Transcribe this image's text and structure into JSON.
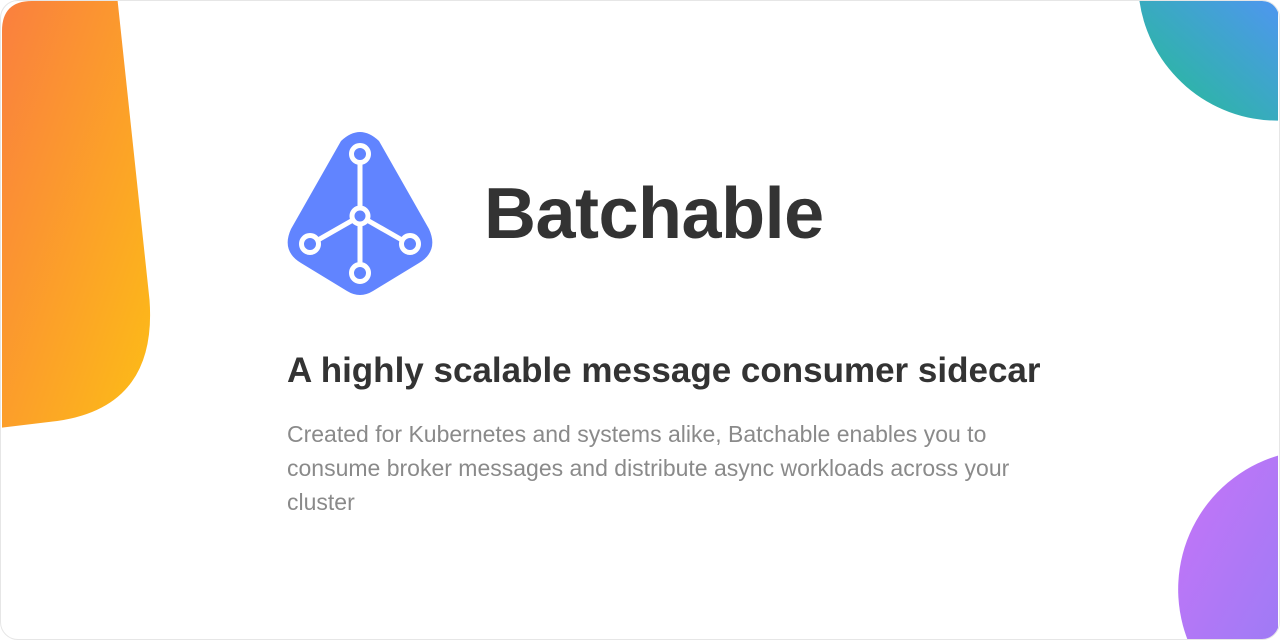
{
  "brand": {
    "name": "Batchable",
    "logo_color": "#6184FF"
  },
  "tagline": "A highly scalable message consumer sidecar",
  "description": "Created for Kubernetes and systems alike, Batchable enables you to consume broker messages and distribute async workloads across your cluster",
  "colors": {
    "orange_start": "#FA7F3F",
    "orange_end": "#FDBD16",
    "teal_start": "#22BF8E",
    "teal_end": "#4F96F0",
    "purple_start": "#C774F8",
    "purple_end": "#9F7BF5"
  }
}
